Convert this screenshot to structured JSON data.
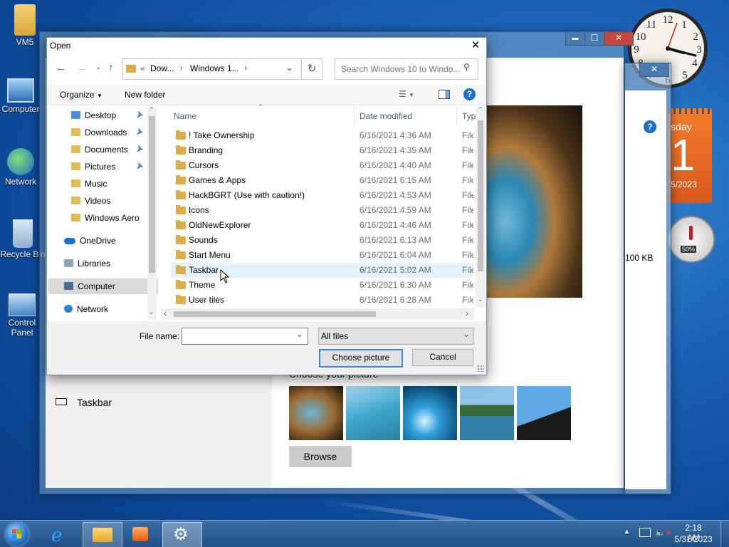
{
  "desktop": {
    "icons": [
      {
        "label": "VM5"
      },
      {
        "label": "Computer"
      },
      {
        "label": "Network"
      },
      {
        "label": "Recycle Bin"
      },
      {
        "label": "Control Panel"
      }
    ],
    "gadgets": {
      "calendar_day": "sday",
      "calendar_date": "1",
      "calendar_year": "5/2023",
      "cpu_meter": "50%"
    }
  },
  "background_window": {
    "controls": {
      "minimize": "▬",
      "maximize": "☐",
      "close": "✕"
    },
    "sidebar_item": "Taskbar",
    "choose_picture_label": "Choose your picture",
    "browse_label": "Browse",
    "size_text": "100 KB"
  },
  "dialog": {
    "title": "Open",
    "close": "✕",
    "breadcrumb": {
      "chevrons": "«",
      "segment1": "Dow...",
      "segment2": "Windows 1...",
      "arrow": "›"
    },
    "search_placeholder": "Search Windows 10 to Windo...",
    "toolbar": {
      "organize": "Organize",
      "new_folder": "New folder",
      "help": "?"
    },
    "nav_pane": [
      {
        "label": "Desktop",
        "pinned": true
      },
      {
        "label": "Downloads",
        "pinned": true
      },
      {
        "label": "Documents",
        "pinned": true
      },
      {
        "label": "Pictures",
        "pinned": true
      },
      {
        "label": "Music",
        "pinned": false
      },
      {
        "label": "Videos",
        "pinned": false
      },
      {
        "label": "Windows Aero",
        "pinned": false
      },
      {
        "label": "OneDrive",
        "pinned": false
      },
      {
        "label": "Libraries",
        "pinned": false
      },
      {
        "label": "Computer",
        "pinned": false
      },
      {
        "label": "Network",
        "pinned": false
      }
    ],
    "columns": {
      "name": "Name",
      "date": "Date modified",
      "type": "Typ"
    },
    "files": [
      {
        "name": "! Take Ownership",
        "date": "6/16/2021 4:36 AM",
        "type": "File"
      },
      {
        "name": "Branding",
        "date": "6/16/2021 4:35 AM",
        "type": "File"
      },
      {
        "name": "Cursors",
        "date": "6/16/2021 4:40 AM",
        "type": "File"
      },
      {
        "name": "Games & Apps",
        "date": "6/16/2021 6:15 AM",
        "type": "File"
      },
      {
        "name": "HackBGRT (Use with caution!)",
        "date": "6/16/2021 4:53 AM",
        "type": "File"
      },
      {
        "name": "Icons",
        "date": "6/16/2021 4:59 AM",
        "type": "File"
      },
      {
        "name": "OldNewExplorer",
        "date": "6/16/2021 4:46 AM",
        "type": "File"
      },
      {
        "name": "Sounds",
        "date": "6/16/2021 6:13 AM",
        "type": "File"
      },
      {
        "name": "Start Menu",
        "date": "6/16/2021 6:04 AM",
        "type": "File"
      },
      {
        "name": "Taskbar",
        "date": "6/16/2021 5:02 AM",
        "type": "File"
      },
      {
        "name": "Theme",
        "date": "6/16/2021 6:30 AM",
        "type": "File"
      },
      {
        "name": "User tiles",
        "date": "6/16/2021 6:28 AM",
        "type": "File"
      }
    ],
    "file_name_label": "File name:",
    "file_name_value": "",
    "filter_value": "All files",
    "choose_button": "Choose picture",
    "cancel_button": "Cancel"
  },
  "taskbar": {
    "time": "2:18 AM",
    "date": "5/31/2023"
  },
  "colors": {
    "accent": "#1b63b8",
    "selected_row": "#e5f1fb",
    "computer_selected": "#d9d9d9",
    "help_icon": "#1b6fd0"
  }
}
